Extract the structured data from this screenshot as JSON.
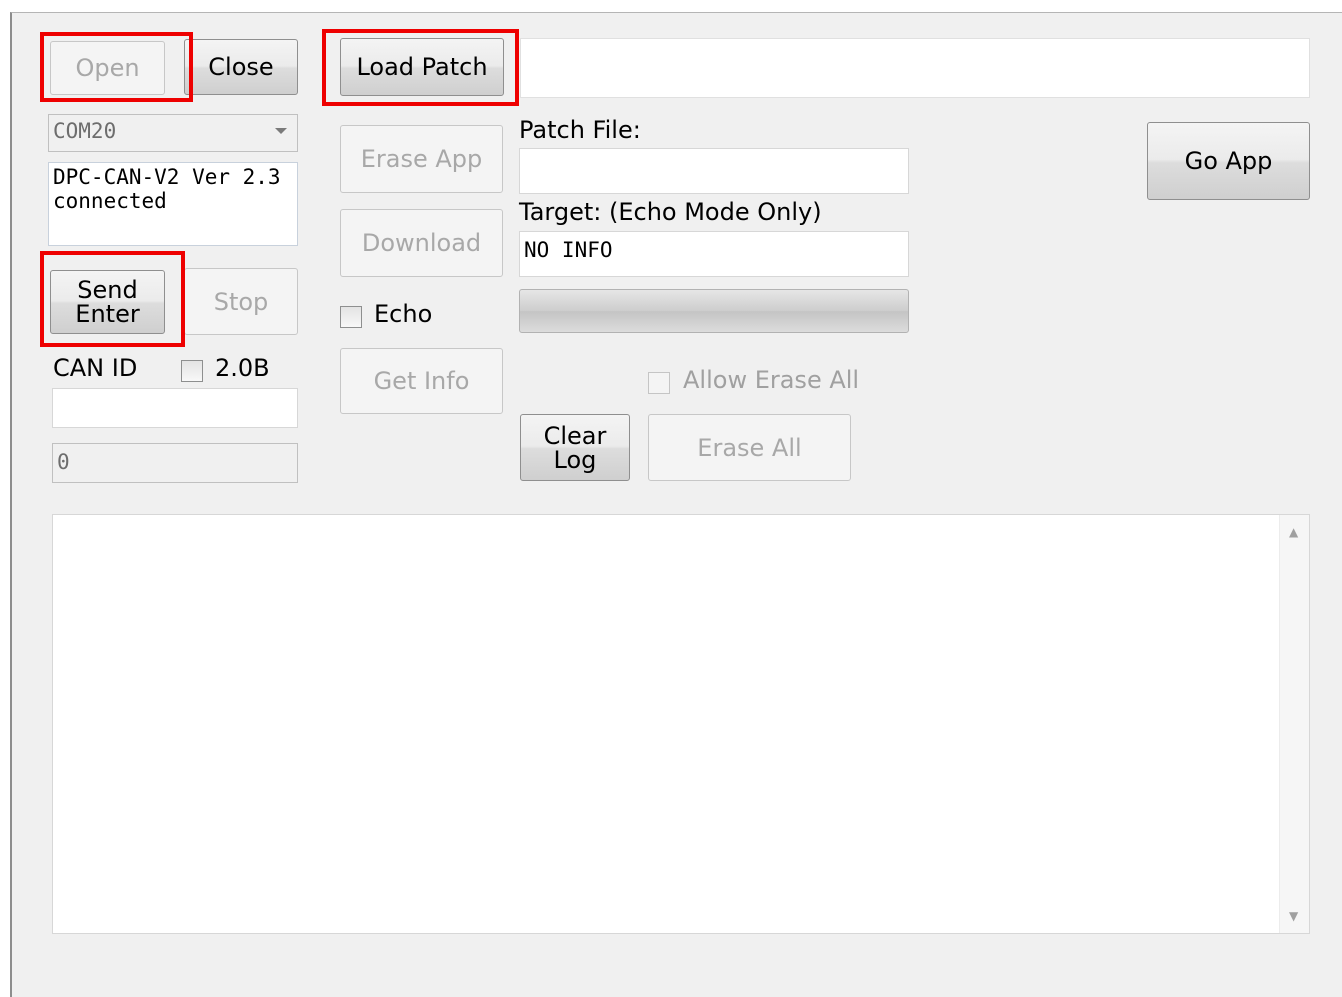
{
  "connection": {
    "open_label": "Open",
    "close_label": "Close",
    "port_value": "COM20",
    "status_text": "DPC-CAN-V2 Ver 2.3\nconnected",
    "send_enter_label": "Send\nEnter",
    "stop_label": "Stop"
  },
  "can": {
    "can_id_label": "CAN ID",
    "can20b_label": "2.0B",
    "can_id_value": "",
    "counter_value": "0"
  },
  "patch": {
    "load_patch_label": "Load Patch",
    "path_value": "",
    "erase_app_label": "Erase App",
    "download_label": "Download",
    "echo_label": "Echo",
    "get_info_label": "Get Info",
    "patch_file_label": "Patch File:",
    "patch_file_value": "",
    "target_label": "Target: (Echo Mode Only)",
    "target_value": "NO INFO",
    "progress": 0,
    "allow_erase_all_label": "Allow Erase All",
    "clear_log_label": "Clear\nLog",
    "erase_all_label": "Erase All",
    "go_app_label": "Go App"
  },
  "log": {
    "content": ""
  },
  "colors": {
    "highlight": "#ee0000",
    "window_bg": "#f0f0f0"
  }
}
